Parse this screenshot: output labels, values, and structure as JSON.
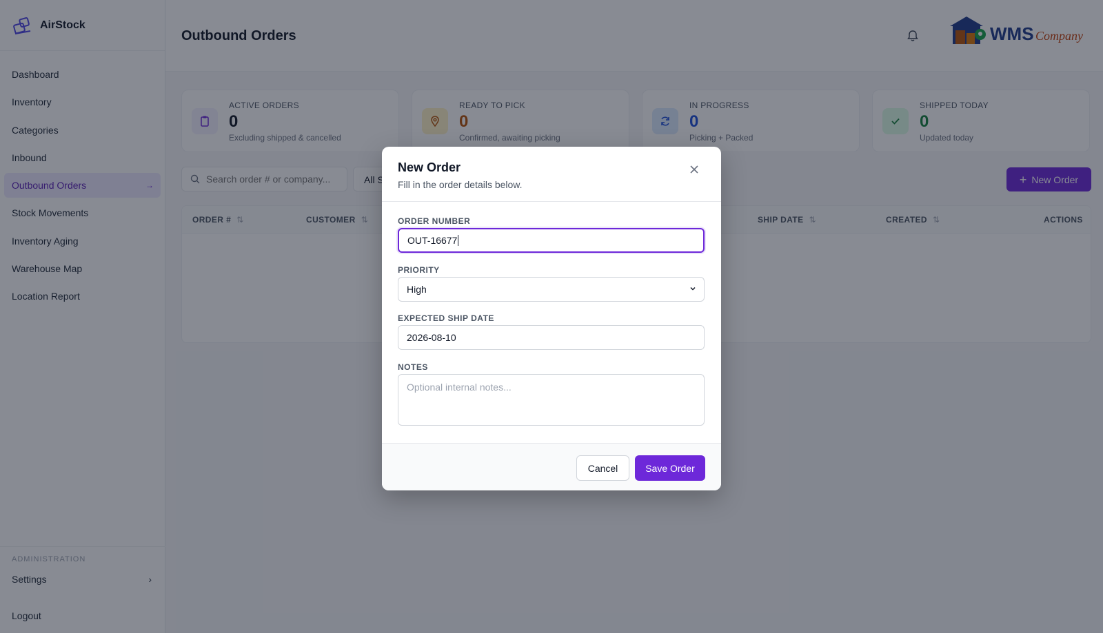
{
  "app": {
    "name": "AirStock"
  },
  "sidebar": {
    "items": [
      {
        "label": "Dashboard"
      },
      {
        "label": "Inventory"
      },
      {
        "label": "Categories"
      },
      {
        "label": "Inbound"
      },
      {
        "label": "Outbound Orders",
        "active": true
      },
      {
        "label": "Stock Movements"
      },
      {
        "label": "Inventory Aging"
      },
      {
        "label": "Warehouse Map"
      },
      {
        "label": "Location Report"
      }
    ],
    "admin_label": "ADMINISTRATION",
    "settings_label": "Settings",
    "logout_label": "Logout"
  },
  "header": {
    "title": "Outbound Orders",
    "logo_text_main": "WMS",
    "logo_text_sub": "Company"
  },
  "stats": [
    {
      "label": "ACTIVE ORDERS",
      "value": "0",
      "sub": "Excluding shipped & cancelled",
      "color": "#111827",
      "icon": "clipboard-icon"
    },
    {
      "label": "READY TO PICK",
      "value": "0",
      "sub": "Confirmed, awaiting picking",
      "color": "#b45309",
      "icon": "location-pin-icon"
    },
    {
      "label": "IN PROGRESS",
      "value": "0",
      "sub": "Picking + Packed",
      "color": "#1d4ed8",
      "icon": "refresh-icon"
    },
    {
      "label": "SHIPPED TODAY",
      "value": "0",
      "sub": "Updated today",
      "color": "#15803d",
      "icon": "check-icon"
    }
  ],
  "toolbar": {
    "search_placeholder": "Search order # or company...",
    "filter_value": "All S",
    "new_order_label": "New Order"
  },
  "table": {
    "columns": [
      "ORDER #",
      "CUSTOMER",
      "SHIP DATE",
      "CREATED",
      "ACTIONS"
    ]
  },
  "modal": {
    "title": "New Order",
    "subtitle": "Fill in the order details below.",
    "order_number_label": "ORDER NUMBER",
    "order_number_value": "OUT-16677",
    "priority_label": "PRIORITY",
    "priority_value": "High",
    "ship_date_label": "EXPECTED SHIP DATE",
    "ship_date_value": "2026-08-10",
    "notes_label": "NOTES",
    "notes_placeholder": "Optional internal notes...",
    "cancel_label": "Cancel",
    "save_label": "Save Order"
  },
  "colors": {
    "accent": "#6d28d9",
    "accent_light": "#ede9fe"
  }
}
